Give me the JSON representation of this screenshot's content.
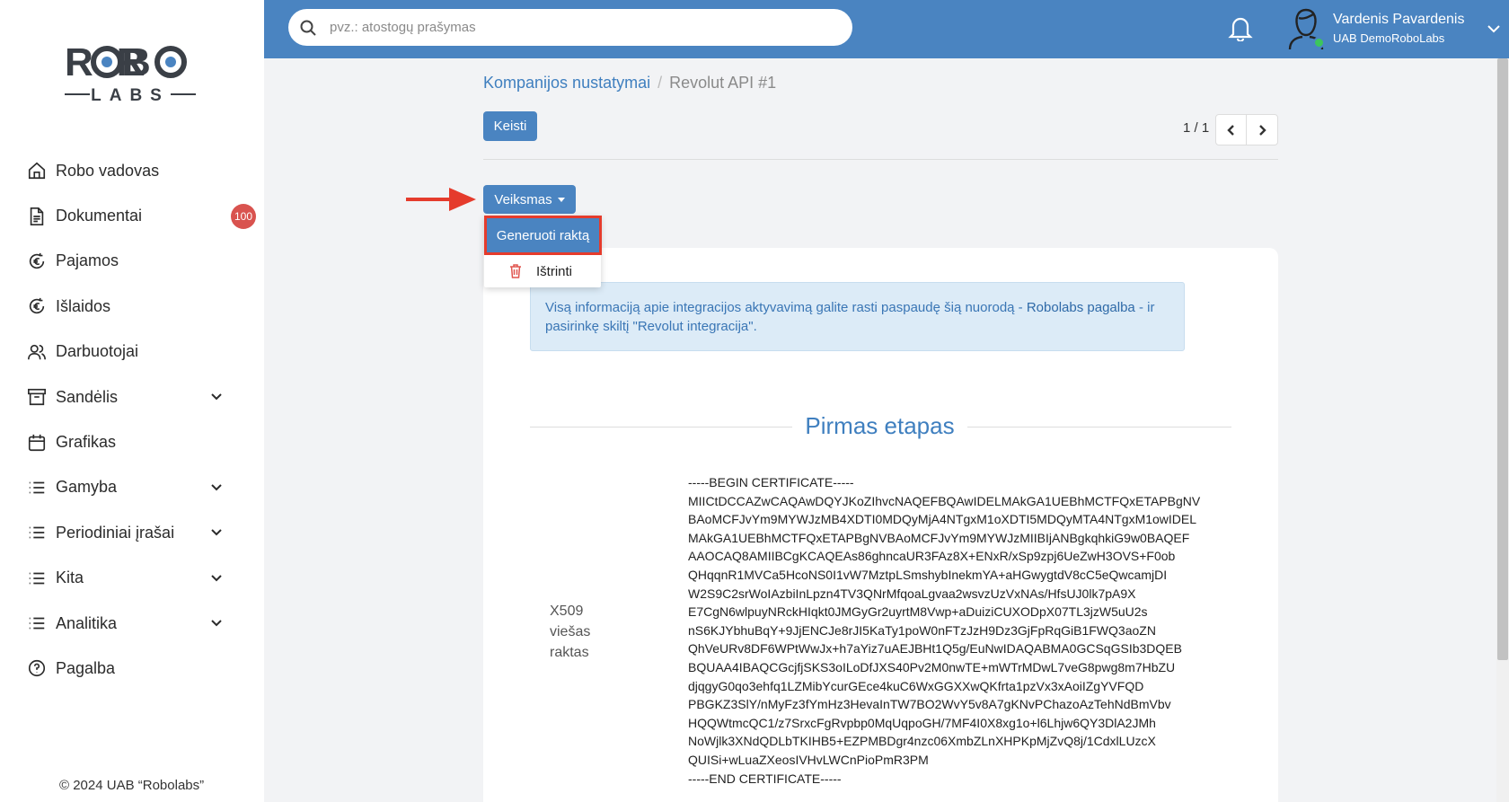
{
  "logo": {
    "top": "ROBO",
    "bottom": "LABS"
  },
  "sidebar": {
    "items": [
      {
        "label": "Robo vadovas",
        "icon": "home-icon"
      },
      {
        "label": "Dokumentai",
        "icon": "document-icon",
        "badge": "100"
      },
      {
        "label": "Pajamos",
        "icon": "euro-cycle-icon"
      },
      {
        "label": "Išlaidos",
        "icon": "euro-cycle-icon"
      },
      {
        "label": "Darbuotojai",
        "icon": "users-icon"
      },
      {
        "label": "Sandėlis",
        "icon": "archive-icon",
        "expandable": true
      },
      {
        "label": "Grafikas",
        "icon": "calendar-icon"
      },
      {
        "label": "Gamyba",
        "icon": "list-icon",
        "expandable": true
      },
      {
        "label": "Periodiniai įrašai",
        "icon": "list-icon",
        "expandable": true
      },
      {
        "label": "Kita",
        "icon": "list-icon",
        "expandable": true
      },
      {
        "label": "Analitika",
        "icon": "list-icon",
        "expandable": true
      },
      {
        "label": "Pagalba",
        "icon": "help-icon"
      }
    ],
    "copyright": "© 2024 UAB “Robolabs”"
  },
  "header": {
    "search_placeholder": "pvz.: atostogų prašymas",
    "user_name": "Vardenis Pavardenis",
    "user_company": "UAB DemoRoboLabs"
  },
  "main": {
    "breadcrumb": {
      "parent": "Kompanijos nustatymai",
      "separator": "/",
      "current": "Revolut API #1"
    },
    "edit_button": "Keisti",
    "pager": "1 / 1",
    "action_button": "Veiksmas",
    "dropdown": {
      "generate": "Generuoti raktą",
      "delete": "Ištrinti"
    },
    "info_text": "Visą informaciją apie integracijos aktyvavimą galite rasti paspaudę šią nuorodą - ",
    "info_link": "Robolabs pagalba",
    "info_text_2": " - ir pasirinkę skiltį \"Revolut integracija\".",
    "section_title": "Pirmas etapas",
    "cert_label": "X509 viešas raktas",
    "certificate": "-----BEGIN CERTIFICATE-----\nMIICtDCCAZwCAQAwDQYJKoZIhvcNAQEFBQAwIDELMAkGA1UEBhMCTFQxETAPBgNV\nBAoMCFJvYm9MYWJzMB4XDTI0MDQyMjA4NTgxM1oXDTI5MDQyMTA4NTgxM1owIDEL\nMAkGA1UEBhMCTFQxETAPBgNVBAoMCFJvYm9MYWJzMIIBIjANBgkqhkiG9w0BAQEF\nAAOCAQ8AMIIBCgKCAQEAs86ghncaUR3FAz8X+ENxR/xSp9zpj6UeZwH3OVS+F0ob\nQHqqnR1MVCa5HcoNS0I1vW7MztpLSmshybInekmYA+aHGwygtdV8cC5eQwcamjDI\nW2S9C2srWoIAzbiInLpzn4TV3QNrMfqoaLgvaa2wsvzUzVxNAs/HfsUJ0lk7pA9X\nE7CgN6wlpuyNRckHIqkt0JMGyGr2uyrtM8Vwp+aDuiziCUXODpX07TL3jzW5uU2s\nnS6KJYbhuBqY+9JjENCJe8rJI5KaTy1poW0nFTzJzH9Dz3GjFpRqGiB1FWQ3aoZN\nQhVeURv8DF6WPtWwJx+h7aYiz7uAEJBHt1Q5g/EuNwIDAQABMA0GCSqGSIb3DQEB\nBQUAA4IBAQCGcjfjSKS3oILoDfJXS40Pv2M0nwTE+mWTrMDwL7veG8pwg8m7HbZU\ndjqgyG0qo3ehfq1LZMibYcurGEce4kuC6WxGGXXwQKfrta1pzVx3xAoiIZgYVFQD\nPBGKZ3SlY/nMyFz3fYmHz3HevaInTW7BO2WvY5v8A7gKNvPChazoAzTehNdBmVbv\nHQQWtmcQC1/z7SrxcFgRvpbp0MqUqpoGH/7MF4I0X8xg1o+l6Lhjw6QY3DlA2JMh\nNoWjlk3XNdQDLbTKIHB5+EZPMBDgr4nzc06XmbZLnXHPKpMjZvQ8j/1CdxlLUzcX\nQUISi+wLuaZXeosIVHvLWCnPioPmR3PM\n-----END CERTIFICATE-----"
  },
  "colors": {
    "primary": "#4a84c1",
    "badge": "#d9534f",
    "highlight": "#e53b2c",
    "online": "#3cc55d"
  }
}
